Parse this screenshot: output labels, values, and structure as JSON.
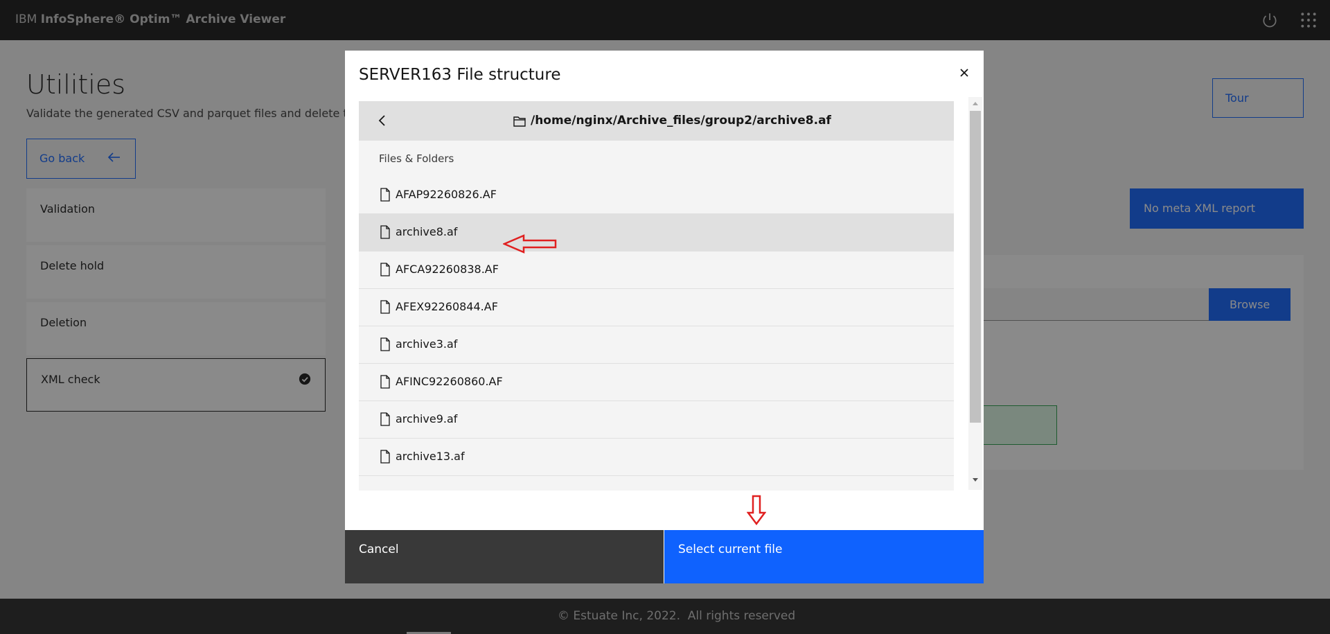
{
  "header": {
    "brand_prefix": "IBM ",
    "brand_name": "InfoSphere® Optim™ Archive Viewer",
    "icons": [
      "power-icon",
      "app-switcher-icon"
    ]
  },
  "page": {
    "title": "Utilities",
    "subtitle": "Validate the generated CSV and parquet files and delete the",
    "go_back_label": "Go back",
    "tour_label": "Tour",
    "sidebar": [
      {
        "label": "Validation"
      },
      {
        "label": "Delete hold"
      },
      {
        "label": "Deletion"
      },
      {
        "label": "XML check",
        "active": true
      }
    ],
    "no_meta_label": "No meta XML report",
    "browse_label": "Browse"
  },
  "modal": {
    "title": "SERVER163 File structure",
    "current_path": "/home/nginx/Archive_files/group2/archive8.af",
    "list_heading": "Files & Folders",
    "files": [
      {
        "name": "AFAP92260826.AF",
        "selected": false
      },
      {
        "name": "archive8.af",
        "selected": true
      },
      {
        "name": "AFCA92260838.AF",
        "selected": false
      },
      {
        "name": "AFEX92260844.AF",
        "selected": false
      },
      {
        "name": "archive3.af",
        "selected": false
      },
      {
        "name": "AFINC92260860.AF",
        "selected": false
      },
      {
        "name": "archive9.af",
        "selected": false
      },
      {
        "name": "archive13.af",
        "selected": false
      }
    ],
    "cancel_label": "Cancel",
    "select_label": "Select current file"
  },
  "footer": {
    "text": "© Estuate Inc, 2022.  All rights reserved"
  },
  "colors": {
    "primary": "#0f62fe",
    "header_bg": "#161616",
    "annotation": "#e02020"
  }
}
